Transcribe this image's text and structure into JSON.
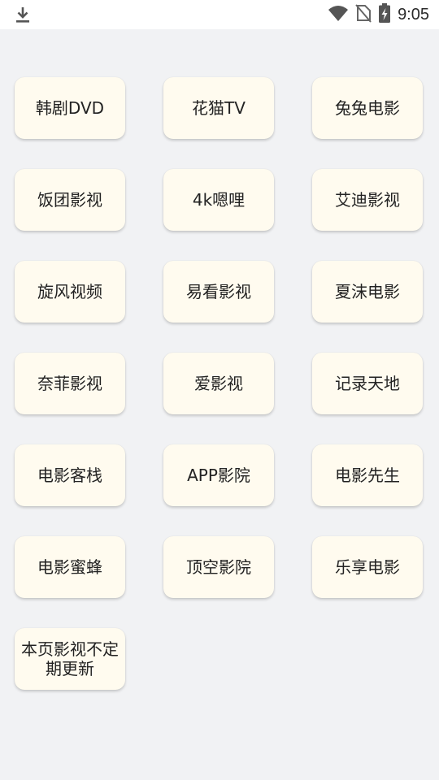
{
  "status_bar": {
    "left_icon": "download-icon",
    "icons": [
      "wifi-icon",
      "no-sim-icon",
      "battery-charging-icon"
    ],
    "time": "9:05"
  },
  "tiles": [
    "韩剧DVD",
    "花猫TV",
    "兔兔电影",
    "饭团影视",
    "4k嗯哩",
    "艾迪影视",
    "旋风视频",
    "易看影视",
    "夏沫电影",
    "奈菲影视",
    "爱影视",
    "记录天地",
    "电影客栈",
    "APP影院",
    "电影先生",
    "电影蜜蜂",
    "顶空影院",
    "乐享电影",
    "本页影视不定期更新"
  ]
}
